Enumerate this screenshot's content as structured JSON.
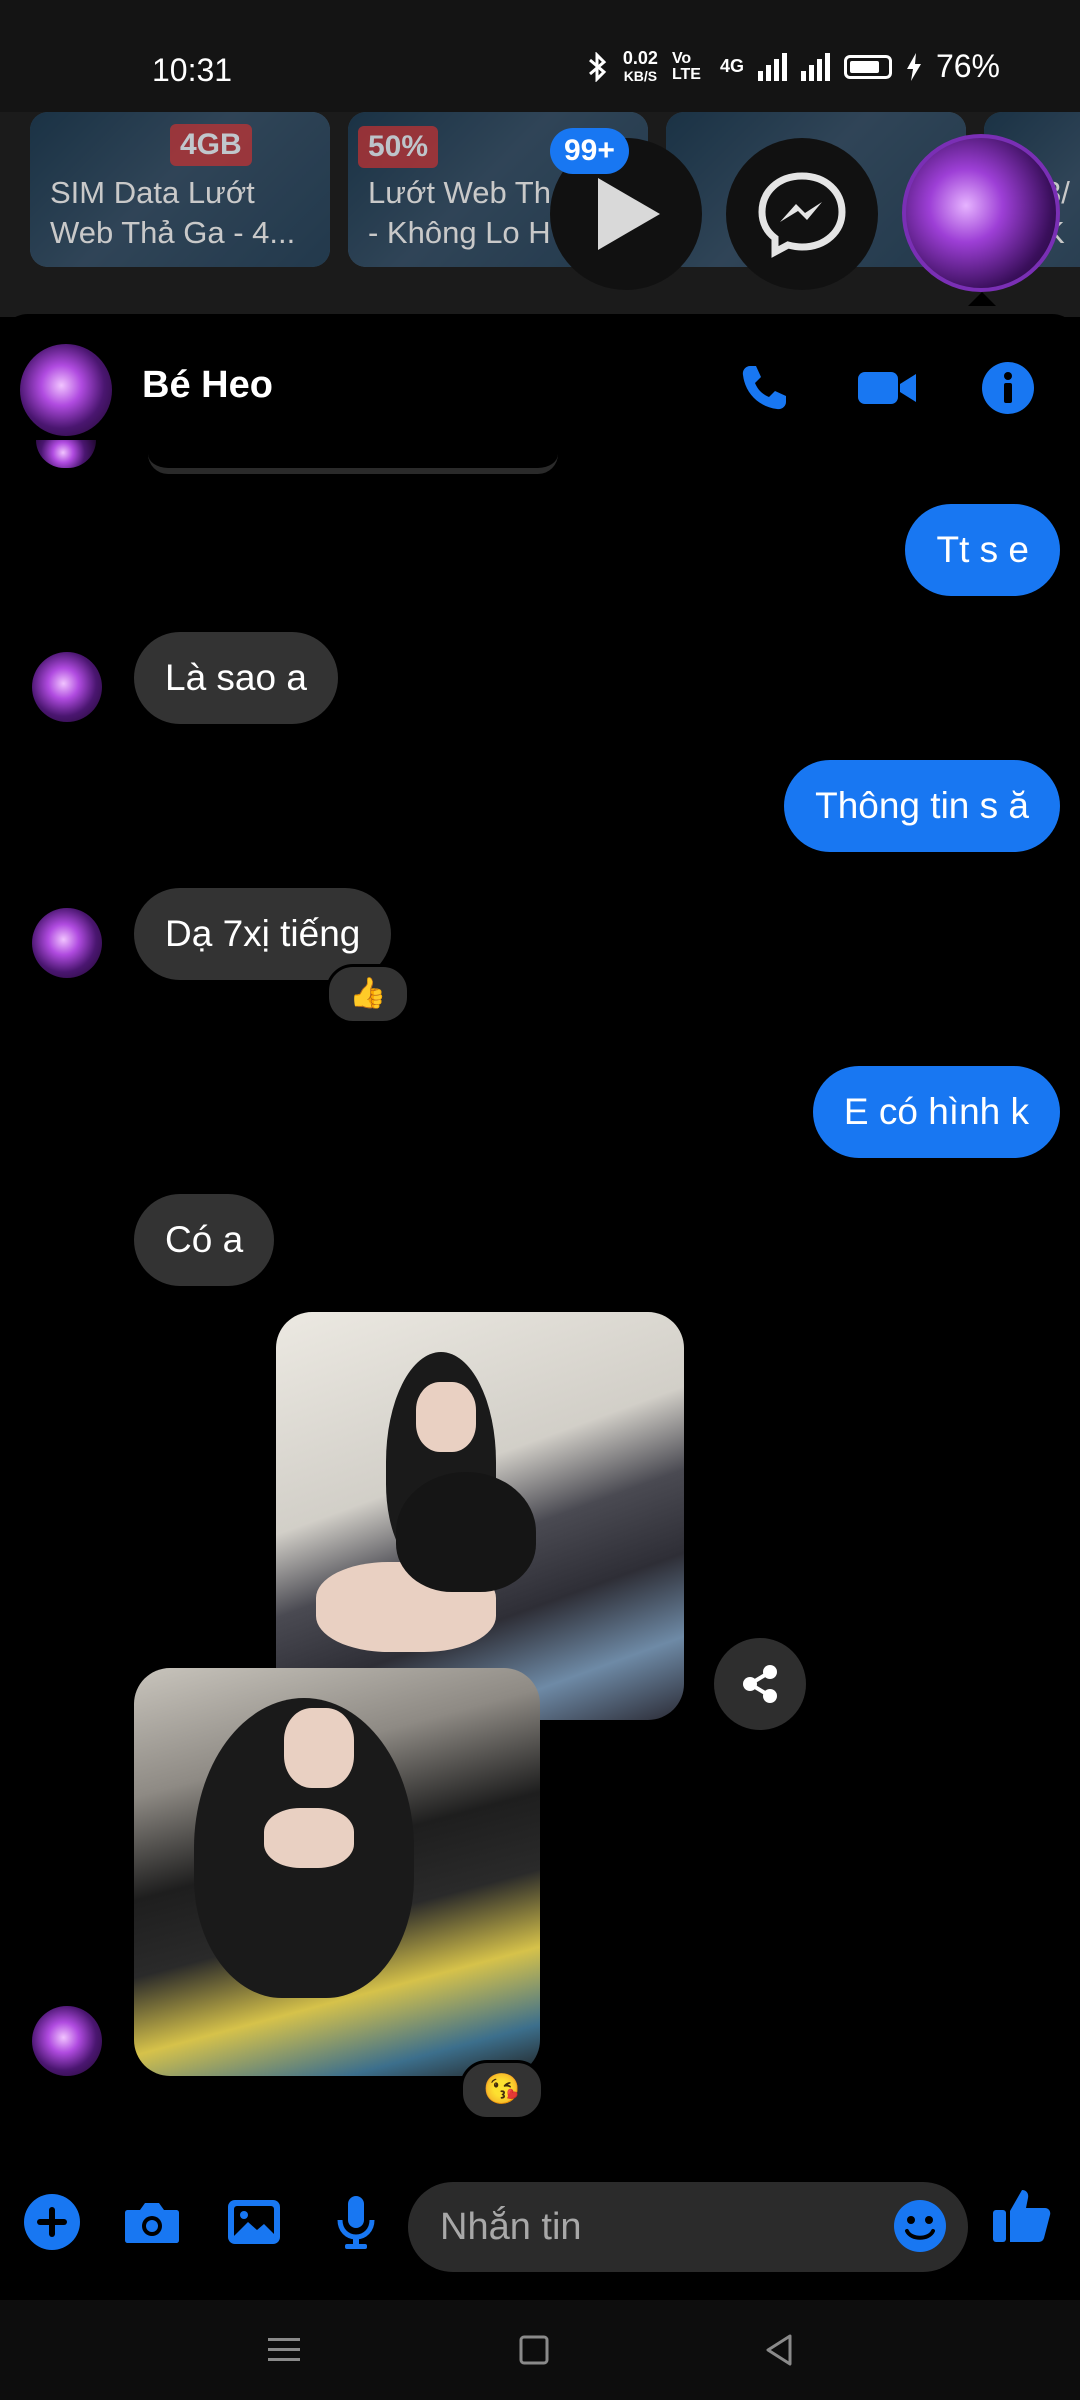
{
  "status_bar": {
    "time": "10:31",
    "speed_value": "0.02",
    "speed_unit": "KB/S",
    "volte": "Vo LTE",
    "network": "4G",
    "battery_percent": "76%"
  },
  "background_ads": [
    {
      "badge": "4GB",
      "text": "SIM Data Lướt\nWeb Thả Ga - 4..."
    },
    {
      "badge": "50%",
      "text": "Lướt Web Th\n- Không Lo H"
    },
    {
      "badge": "",
      "text": "..."
    },
    {
      "badge": "",
      "text": "3/\nK"
    }
  ],
  "chat_heads": {
    "video_badge": "99+"
  },
  "conversation": {
    "contact_name": "Bé Heo",
    "messages": [
      {
        "direction": "outgoing",
        "text": "Tt s e"
      },
      {
        "direction": "incoming",
        "text": "Là sao a"
      },
      {
        "direction": "outgoing",
        "text": "Thông tin s ă"
      },
      {
        "direction": "incoming",
        "text": "Dạ 7xị tiếng",
        "reaction": "👍"
      },
      {
        "direction": "outgoing",
        "text": "E có hình k"
      },
      {
        "direction": "incoming",
        "text": "Có a"
      }
    ],
    "photo_reaction": "😘"
  },
  "composer": {
    "placeholder": "Nhắn tin"
  },
  "colors": {
    "accent": "#1877f2",
    "incoming_bubble": "#333333",
    "background": "#000000"
  },
  "icons": [
    "phone-icon",
    "video-call-icon",
    "info-icon",
    "plus-icon",
    "camera-icon",
    "gallery-icon",
    "microphone-icon",
    "emoji-icon",
    "like-icon",
    "share-icon",
    "messenger-icon",
    "play-icon"
  ]
}
